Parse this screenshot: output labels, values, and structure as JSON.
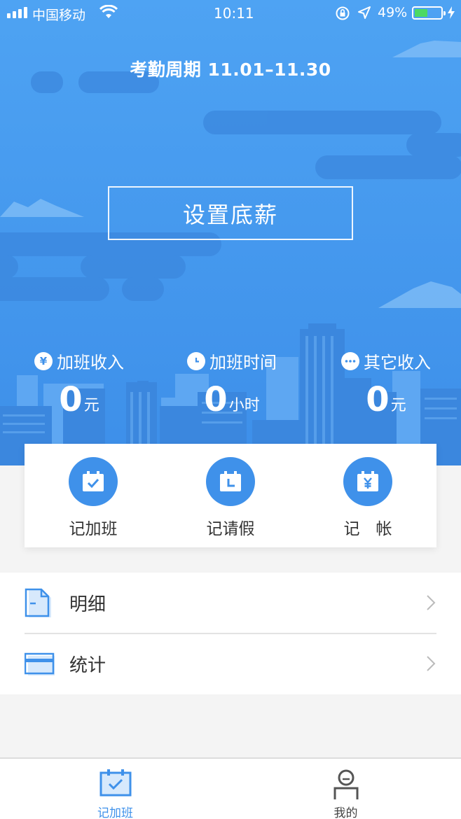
{
  "status_bar": {
    "carrier": "中国移动",
    "time": "10:11",
    "battery": "49%",
    "battery_level": 0.49,
    "icons": [
      "signal-icon",
      "wifi-icon",
      "orientation-lock-icon",
      "location-icon",
      "battery-icon",
      "charging-icon"
    ]
  },
  "header": {
    "period": "考勤周期 11.01–11.30",
    "set_salary_label": "设置底薪"
  },
  "stats": [
    {
      "label": "加班收入",
      "value": "0",
      "unit": "元",
      "icon": "yen-icon"
    },
    {
      "label": "加班时间",
      "value": "0",
      "unit": "小时",
      "icon": "clock-icon"
    },
    {
      "label": "其它收入",
      "value": "0",
      "unit": "元",
      "icon": "more-icon"
    }
  ],
  "actions": [
    {
      "label": "记加班",
      "icon": "calendar-check-icon"
    },
    {
      "label": "记请假",
      "icon": "calendar-clock-icon"
    },
    {
      "label": "记　帐",
      "icon": "calendar-yen-icon"
    }
  ],
  "menu": [
    {
      "label": "明细",
      "icon": "document-icon"
    },
    {
      "label": "统计",
      "icon": "card-icon"
    }
  ],
  "tabbar": {
    "tabs": [
      {
        "label": "记加班",
        "icon": "calendar-check-icon",
        "active": true
      },
      {
        "label": "我的",
        "icon": "person-icon",
        "active": false
      }
    ]
  },
  "colors": {
    "primary": "#3f91ea",
    "hero_top": "#4ea3f3",
    "hero_bottom": "#3d8fe9",
    "battery_fill": "#4cd964",
    "inactive_tab": "#555555"
  }
}
